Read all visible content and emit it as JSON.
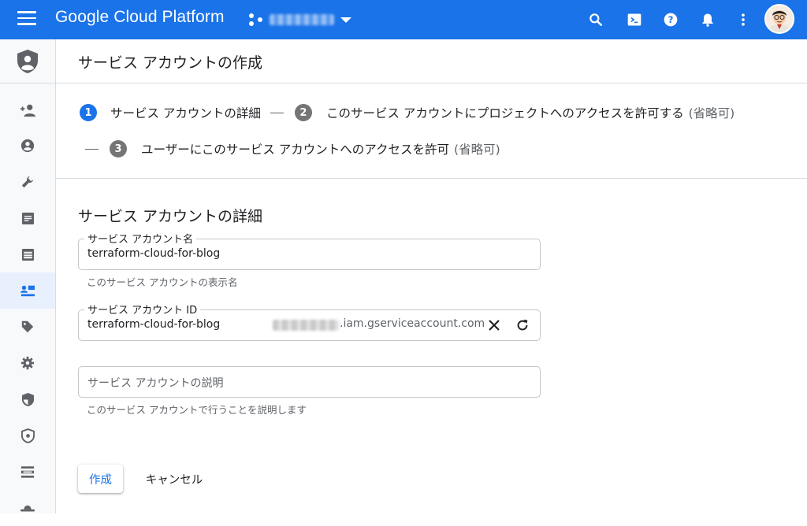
{
  "topbar": {
    "brand": "Google Cloud Platform",
    "project_name": "",
    "icons": [
      "search-icon",
      "cloud-shell-icon",
      "help-icon",
      "notifications-icon",
      "more-vert-icon"
    ],
    "accent": "#1a73e8"
  },
  "sidebar": {
    "items": [
      {
        "icon": "add-person-icon"
      },
      {
        "icon": "account-circle-icon"
      },
      {
        "icon": "wrench-icon"
      },
      {
        "icon": "document-icon"
      },
      {
        "icon": "calendar-icon"
      },
      {
        "icon": "service-account-icon",
        "active": true
      },
      {
        "icon": "tag-icon"
      },
      {
        "icon": "gear-icon"
      },
      {
        "icon": "shield-icon"
      },
      {
        "icon": "shield-settings-icon"
      },
      {
        "icon": "list-icon"
      },
      {
        "icon": "hat-icon"
      }
    ]
  },
  "page": {
    "title": "サービス アカウントの作成"
  },
  "stepper": {
    "steps": [
      {
        "number": "1",
        "label": "サービス アカウントの詳細",
        "optional": ""
      },
      {
        "number": "2",
        "label": "このサービス アカウントにプロジェクトへのアクセスを許可する",
        "optional": "(省略可)"
      },
      {
        "number": "3",
        "label": "ユーザーにこのサービス アカウントへのアクセスを許可",
        "optional": "(省略可)"
      }
    ]
  },
  "form": {
    "section_title": "サービス アカウントの詳細",
    "name_field": {
      "label": "サービス アカウント名",
      "value": "terraform-cloud-for-blog",
      "hint": "このサービス アカウントの表示名"
    },
    "id_field": {
      "label": "サービス アカウント ID",
      "value": "terraform-cloud-for-blog",
      "suffix": ".iam.gserviceaccount.com"
    },
    "description_field": {
      "placeholder": "サービス アカウントの説明",
      "hint": "このサービス アカウントで行うことを説明します"
    },
    "create_button": "作成",
    "cancel_button": "キャンセル"
  }
}
